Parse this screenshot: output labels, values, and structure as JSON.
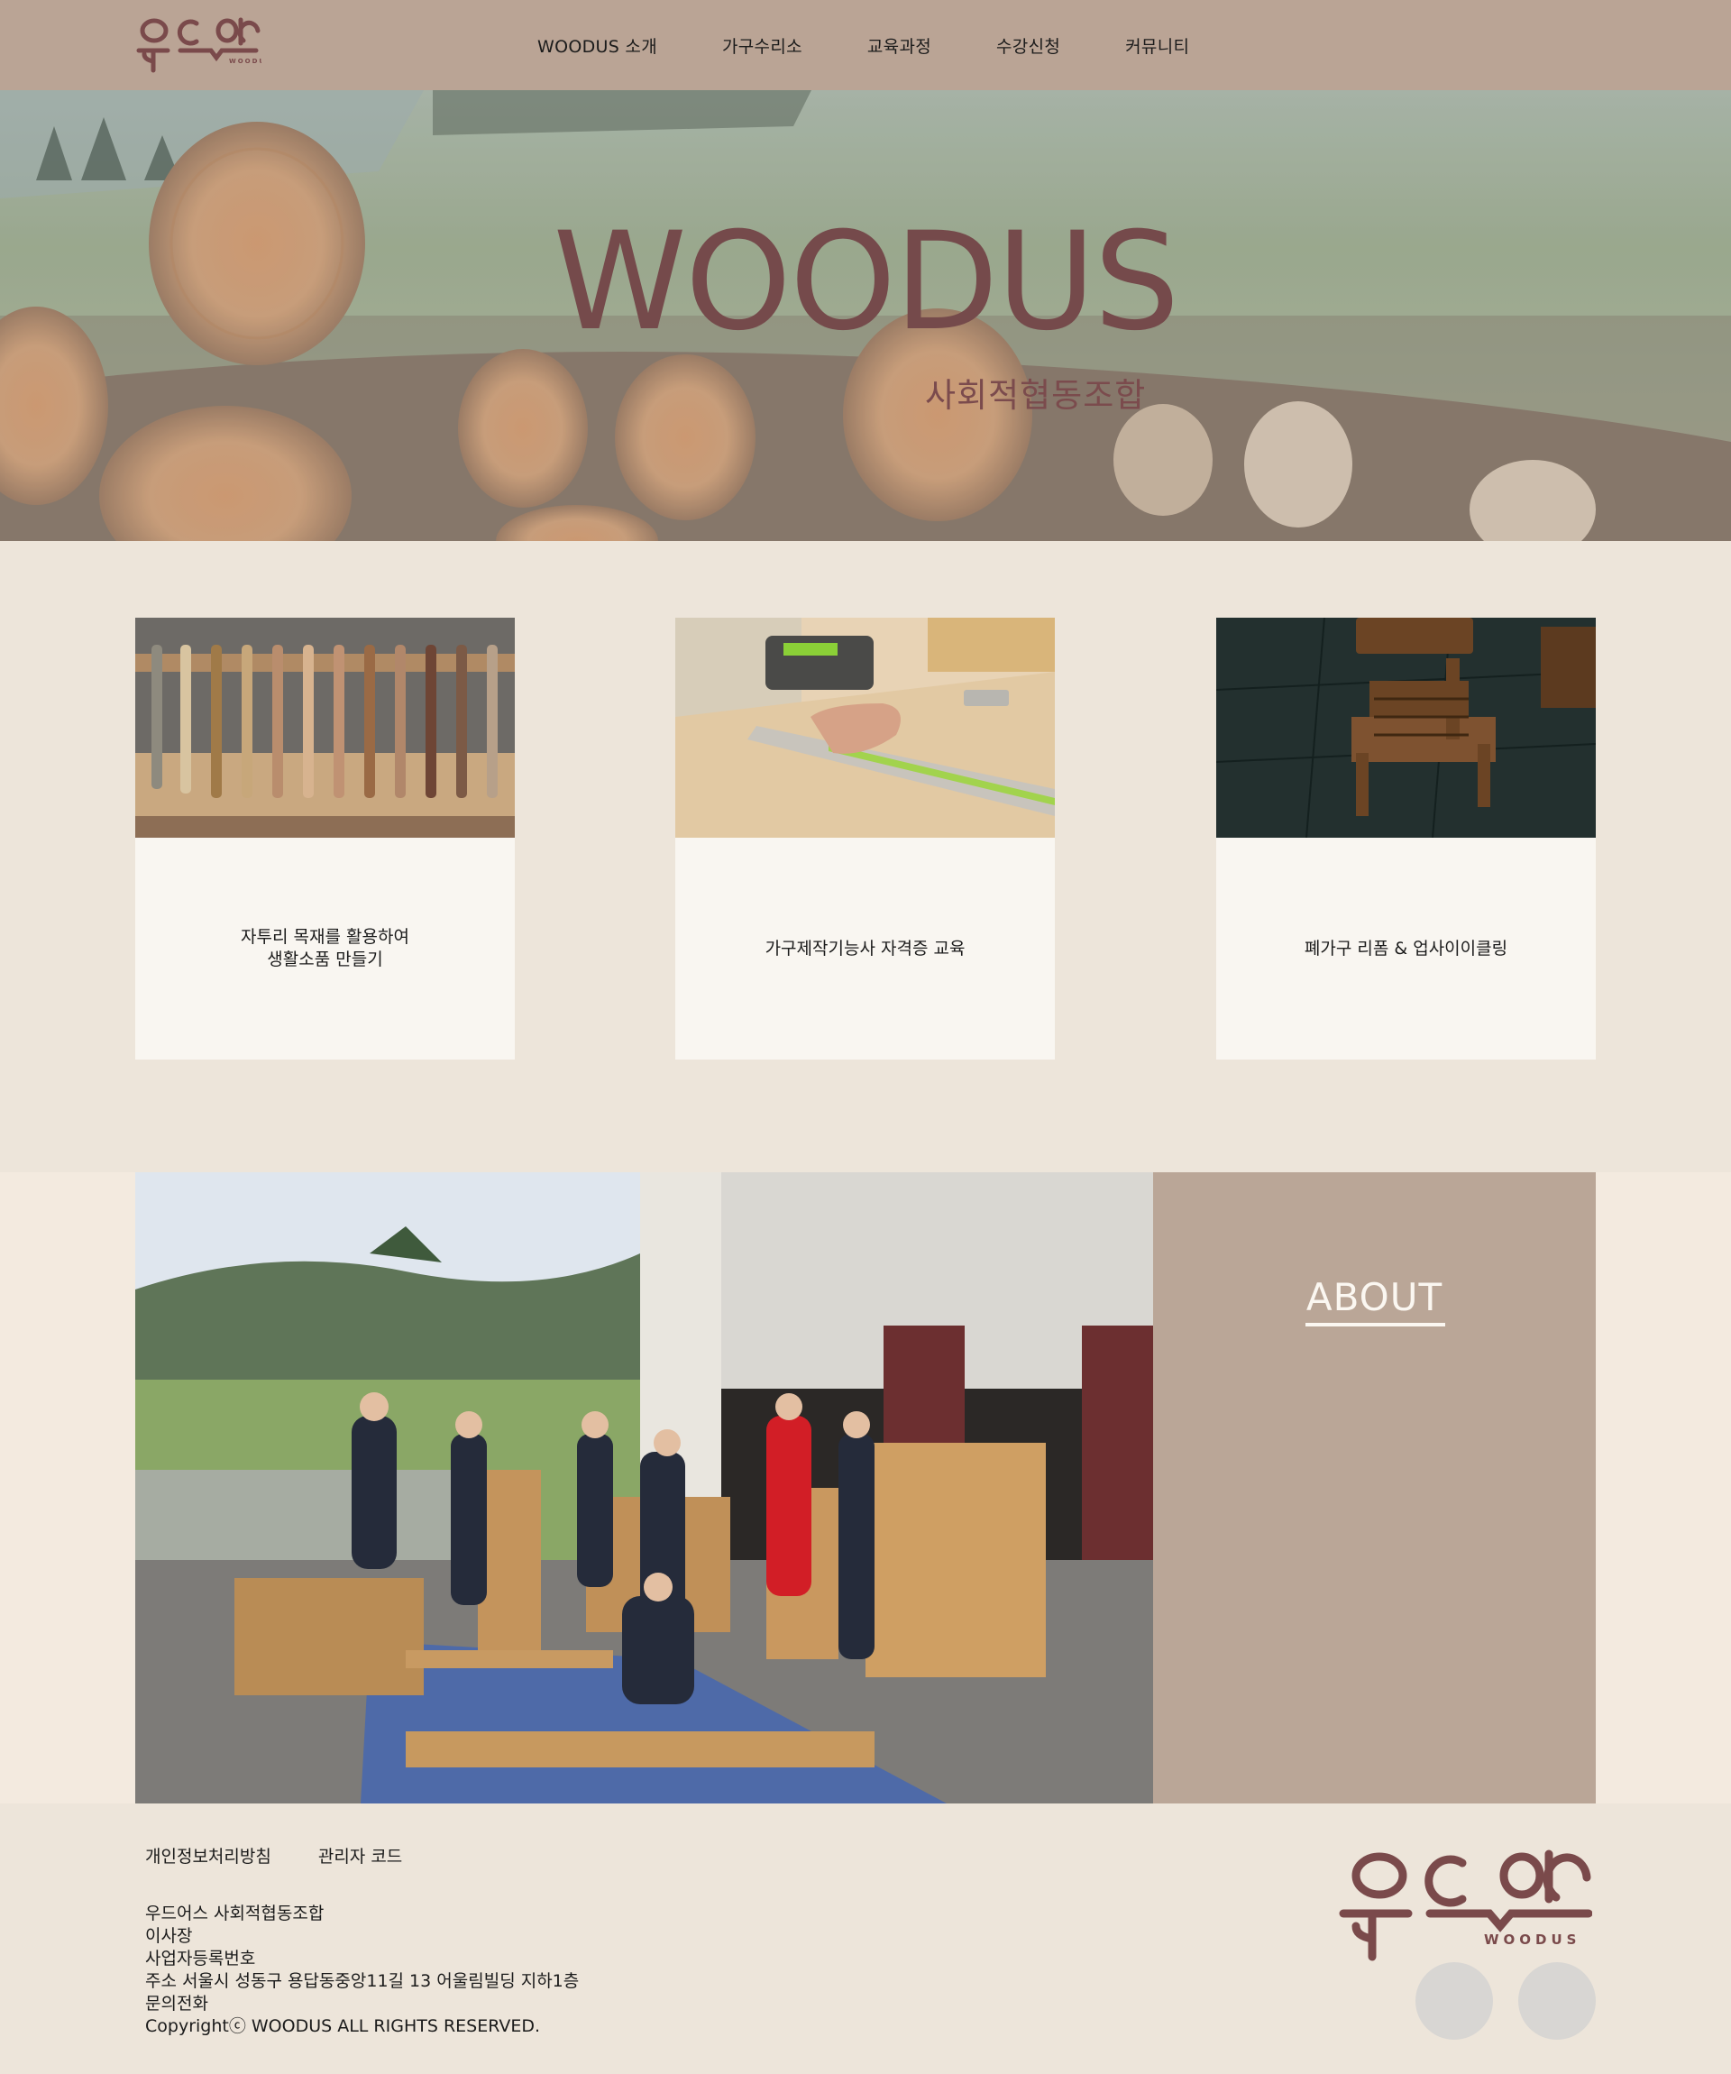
{
  "header": {
    "logo_text": "우드어스",
    "logo_sub": "WOODUS",
    "nav": [
      "WOODUS 소개",
      "가구수리소",
      "교육과정",
      "수강신청",
      "커뮤니티"
    ]
  },
  "hero": {
    "title": "WOODUS",
    "subtitle": "사회적협동조합"
  },
  "cards": [
    {
      "text": "자투리 목재를 활용하여\n생활소품 만들기"
    },
    {
      "text": "가구제작기능사 자격증 교육"
    },
    {
      "text": "폐가구 리폼 & 업사이이클링"
    }
  ],
  "about": {
    "title": "ABOUT"
  },
  "footer": {
    "links": [
      "개인정보처리방침",
      "관리자 코드"
    ],
    "info": [
      "우드어스 사회적협동조합",
      "이사장",
      "사업자등록번호",
      "주소 서울시 성동구 용답동중앙11길 13 어울림빌딩 지하1층",
      "문의전화",
      "Copyrightⓒ WOODUS ALL RIGHTS RESERVED."
    ],
    "logo_text": "우드어스",
    "logo_sub": "WOODUS"
  },
  "colors": {
    "header_bg": "#baa495",
    "brand": "#754a4b",
    "page_bg": "#ede5da",
    "card_bg": "#f9f6f1",
    "about_panel": "#baa697"
  }
}
